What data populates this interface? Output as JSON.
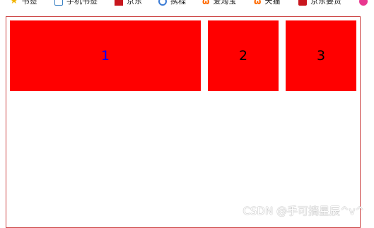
{
  "bookmarks": [
    {
      "icon": "star-icon",
      "label": "书签"
    },
    {
      "icon": "phone-icon",
      "label": "手机书签"
    },
    {
      "icon": "jd-icon",
      "label": "京东"
    },
    {
      "icon": "globe-icon",
      "label": "携程"
    },
    {
      "icon": "taobao-icon",
      "label": "爱淘宝"
    },
    {
      "icon": "taobao-icon",
      "label": "天猫"
    },
    {
      "icon": "jd-icon",
      "label": "京东要贷"
    },
    {
      "icon": "circle-icon",
      "label": ""
    }
  ],
  "boxes": [
    {
      "label": "1"
    },
    {
      "label": "2"
    },
    {
      "label": "3"
    }
  ],
  "colors": {
    "box_background": "#ff0000",
    "box_1_text": "#0000ff",
    "box_text": "#000000",
    "container_border": "#cc4444"
  },
  "watermark": "CSDN @手可摘星辰^v^"
}
